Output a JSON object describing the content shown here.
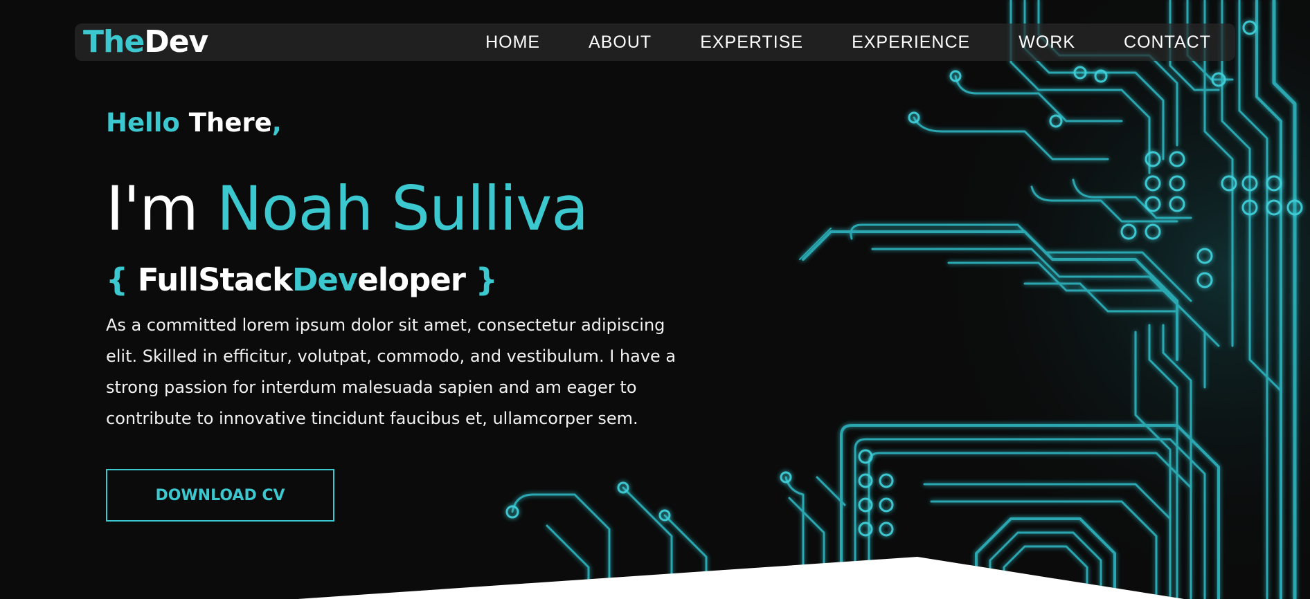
{
  "brand": {
    "logo_part1": "The",
    "logo_part2": "Dev"
  },
  "nav": {
    "items": [
      {
        "label": "HOME"
      },
      {
        "label": "ABOUT"
      },
      {
        "label": "EXPERTISE"
      },
      {
        "label": "EXPERIENCE"
      },
      {
        "label": "WORK"
      },
      {
        "label": "CONTACT"
      }
    ]
  },
  "hero": {
    "greeting_word1": "Hello",
    "greeting_word2": "There",
    "greeting_punct": ",",
    "intro": "I'm",
    "name": "Noah Sulliva",
    "role_open": "{",
    "role_part1": "FullStack",
    "role_part2": "Dev",
    "role_part3": "eloper",
    "role_close": "}",
    "bio": "As a committed lorem ipsum dolor sit amet, consectetur adipiscing elit. Skilled in efficitur, volutpat, commodo, and vestibulum. I have a strong passion for interdum malesuada sapien and am eager to contribute to innovative tincidunt faucibus et, ullamcorper sem.",
    "cta_label": "DOWNLOAD CV"
  },
  "colors": {
    "accent": "#3cc8cf",
    "background": "#0b0b0b",
    "text": "#ffffff"
  }
}
